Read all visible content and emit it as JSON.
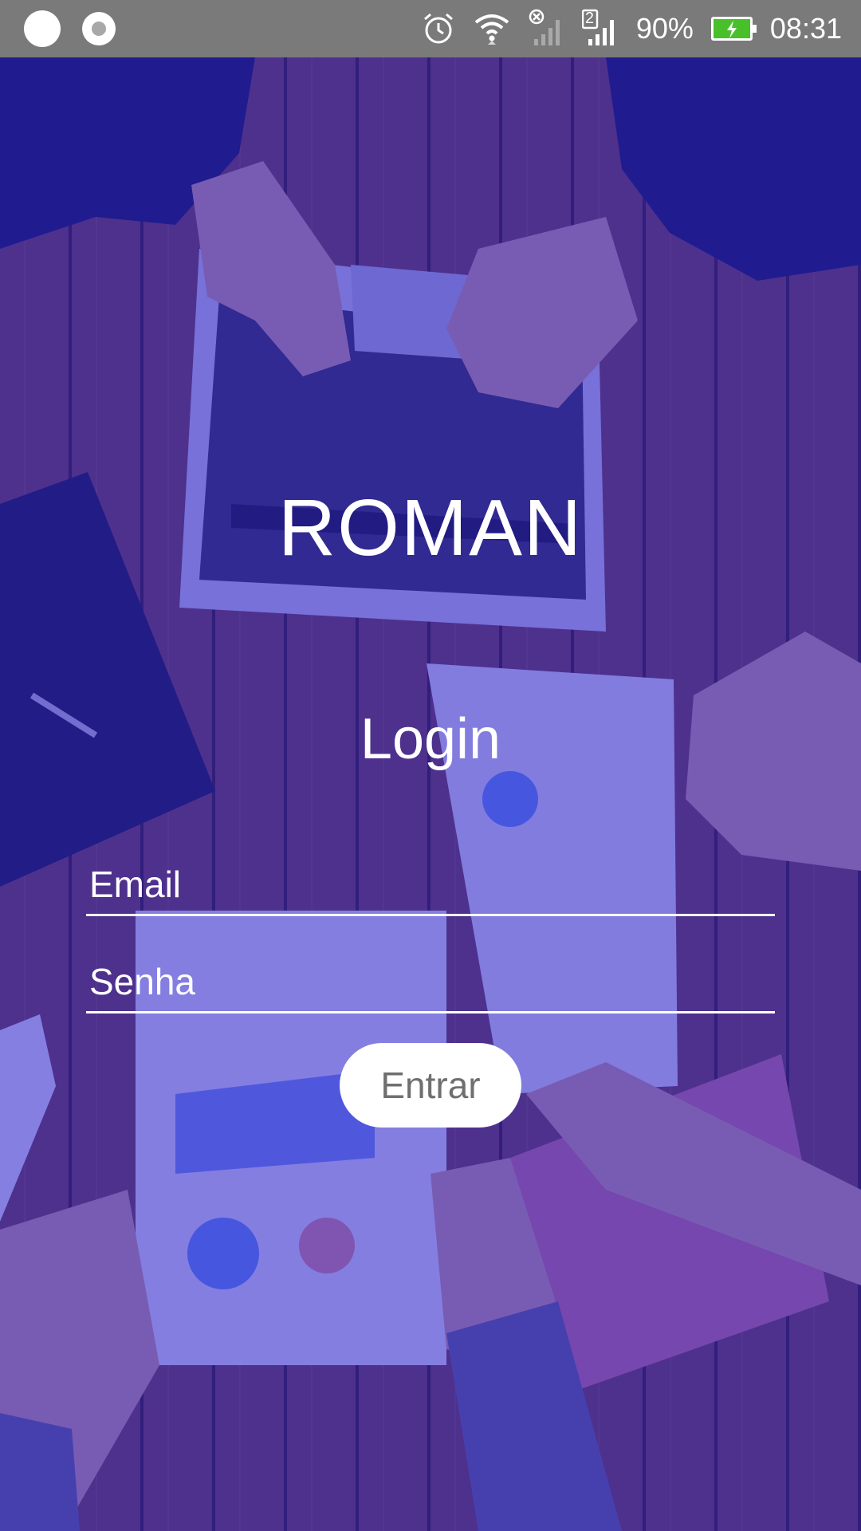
{
  "status_bar": {
    "battery_percent": "90%",
    "time": "08:31",
    "sim_badge": "2",
    "icons": [
      "notification-dot-icon",
      "notification-ring-icon",
      "alarm-icon",
      "wifi-icon",
      "no-signal-icon",
      "signal-icon",
      "battery-charging-icon"
    ]
  },
  "app": {
    "title": "ROMAN"
  },
  "login": {
    "heading": "Login",
    "email_placeholder": "Email",
    "password_placeholder": "Senha",
    "submit_label": "Entrar"
  },
  "colors": {
    "overlay": "#281ed2",
    "status_bar": "#7a7a7a",
    "battery_fill": "#48c02a",
    "button_text": "#6f6f6f"
  }
}
